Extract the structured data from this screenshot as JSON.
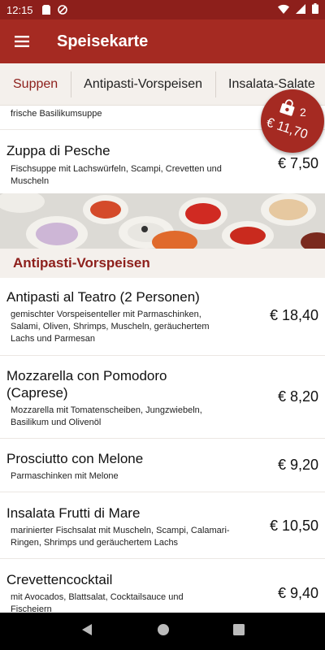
{
  "status_bar": {
    "time": "12:15",
    "icons": [
      "sd-card-icon",
      "do-not-disturb-icon",
      "wifi-icon",
      "signal-icon",
      "battery-icon"
    ]
  },
  "app_bar": {
    "title": "Speisekarte",
    "menu_icon": "hamburger-menu-icon"
  },
  "tabs": [
    {
      "label": "Suppen",
      "active": true
    },
    {
      "label": "Antipasti-Vorspeisen",
      "active": false
    },
    {
      "label": "Insalata-Salate",
      "active": false
    }
  ],
  "items": {
    "partial_top": {
      "desc": "frische Basilikumsuppe"
    },
    "zuppa": {
      "name": "Zuppa di Pesche",
      "desc": "Fischsuppe mit Lachswürfeln, Scampi, Crevetten und Muscheln",
      "price": "€ 7,50"
    },
    "teatro": {
      "name": "Antipasti al Teatro (2 Personen)",
      "desc": "gemischter Vorspeisenteller mit Parmaschinken, Salami, Oliven, Shrimps, Muscheln, geräuchertem Lachs und Parmesan",
      "price": "€ 18,40"
    },
    "mozzarella": {
      "name": "Mozzarella con Pomodoro (Caprese)",
      "desc": "Mozzarella mit Tomatenscheiben, Jungzwiebeln, Basilikum und Olivenöl",
      "price": "€ 8,20"
    },
    "prosciutto": {
      "name": "Prosciutto con Melone",
      "desc": "Parmaschinken mit Melone",
      "price": "€ 9,20"
    },
    "frutti": {
      "name": "Insalata Frutti di Mare",
      "desc": "marinierter Fischsalat mit Muscheln, Scampi, Calamari-Ringen, Shrimps und geräuchertem Lachs",
      "price": "€ 10,50"
    },
    "crevetten": {
      "name": "Crevettencocktail",
      "desc": "mit Avocados, Blattsalat, Cocktailsauce und Fischeiern",
      "price": "€ 9,40"
    }
  },
  "section": {
    "title": "Antipasti-Vorspeisen"
  },
  "cart": {
    "count": "2",
    "total": "€ 11,70",
    "icon": "shopping-bag-icon"
  },
  "colors": {
    "primary": "#a52a22",
    "primary_dark": "#8d1f1b",
    "tab_bg": "#f4f0ec"
  },
  "nav": {
    "icons": [
      "back-icon",
      "home-icon",
      "recents-icon"
    ]
  }
}
